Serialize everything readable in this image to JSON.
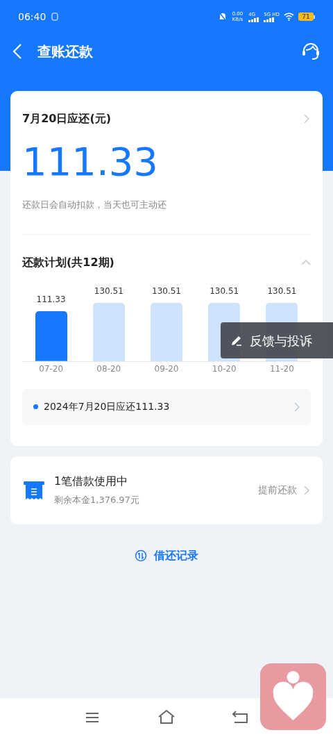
{
  "status_bar": {
    "time": "06:40",
    "net_speed": "0.00",
    "net_unit": "KB/s",
    "net_4g": "4G",
    "net_5g": "5G HD",
    "battery": "71"
  },
  "header": {
    "title": "查账还款"
  },
  "due_card": {
    "title": "7月20日应还(元)",
    "amount": "111.33",
    "note": "还款日会自动扣款，当天也可主动还",
    "plan": {
      "title": "还款计划(共12期)",
      "expanded": true,
      "chart_data": {
        "type": "bar",
        "categories": [
          "07-20",
          "08-20",
          "09-20",
          "10-20",
          "11-20"
        ],
        "series": [
          {
            "color": "#1677ff",
            "values": [
              111.33,
              null,
              null,
              null,
              null
            ]
          },
          {
            "color": "#cfe2fb",
            "values": [
              null,
              130.51,
              130.51,
              130.51,
              130.51
            ]
          }
        ],
        "data_labels": true
      },
      "detail": "2024年7月20日应还111.33"
    }
  },
  "loan_card": {
    "title": "1笔借款使用中",
    "subtitle": "剩余本金1,376.97元",
    "action": "提前还款"
  },
  "records_link": "借还记录",
  "feedback": "反馈与投诉"
}
